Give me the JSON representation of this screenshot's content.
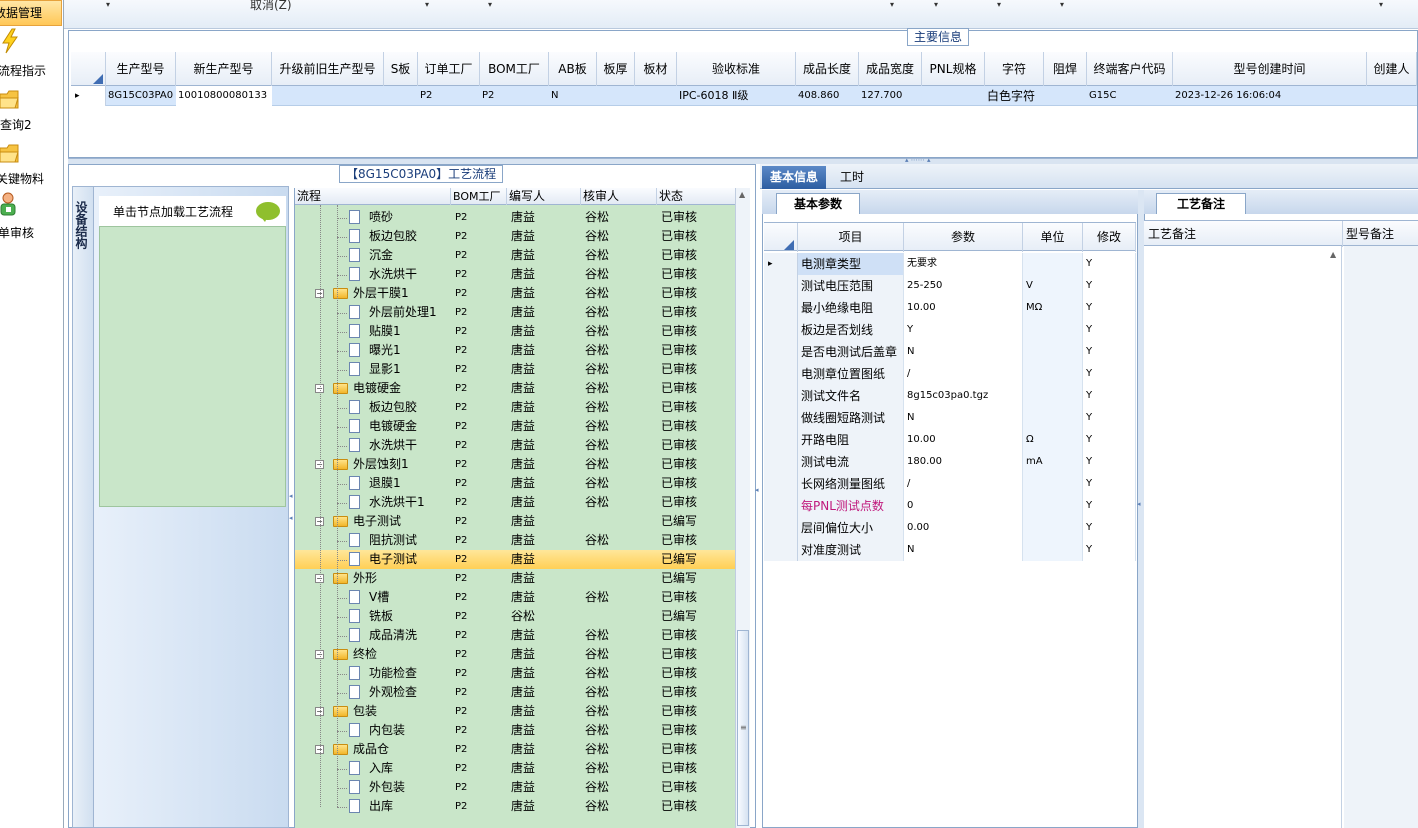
{
  "leftnav": {
    "active_label": "数据管理",
    "items": [
      {
        "label": "流程指示",
        "icon": "lightning-icon"
      },
      {
        "label": "查询2",
        "icon": "folder-icon"
      },
      {
        "label": "关键物料",
        "icon": "folder-icon"
      },
      {
        "label": "单审核",
        "icon": "user-icon"
      }
    ]
  },
  "toolbar": {
    "cancel_label": "取消(Z)"
  },
  "main_info": {
    "legend": "主要信息",
    "columns": [
      "生产型号",
      "新生产型号",
      "升级前旧生产型号",
      "S板",
      "订单工厂",
      "BOM工厂",
      "AB板",
      "板厚",
      "板材",
      "验收标准",
      "成品长度",
      "成品宽度",
      "PNL规格",
      "字符",
      "阻焊",
      "终端客户代码",
      "型号创建时间",
      "创建人"
    ],
    "row": [
      "8G15C03PA0",
      "10010800080133",
      "",
      "",
      "P2",
      "P2",
      "N",
      "",
      "",
      "IPC-6018 Ⅱ级",
      "408.860",
      "127.700",
      "",
      "白色字符",
      "",
      "G15C",
      "2023-12-26 16:06:04",
      ""
    ]
  },
  "process": {
    "legend": "【8G15C03PA0】工艺流程",
    "vtab_label": "设备结构",
    "node_hint": "单击节点加载工艺流程",
    "columns": [
      "流程",
      "BOM工厂",
      "编写人",
      "核审人",
      "状态"
    ],
    "rows": [
      {
        "name": "喷砂",
        "level": 2,
        "bom": "P2",
        "writer": "唐益",
        "reviewer": "谷松",
        "status": "已审核"
      },
      {
        "name": "板边包胶",
        "level": 2,
        "bom": "P2",
        "writer": "唐益",
        "reviewer": "谷松",
        "status": "已审核"
      },
      {
        "name": "沉金",
        "level": 2,
        "bom": "P2",
        "writer": "唐益",
        "reviewer": "谷松",
        "status": "已审核"
      },
      {
        "name": "水洗烘干",
        "level": 2,
        "bom": "P2",
        "writer": "唐益",
        "reviewer": "谷松",
        "status": "已审核"
      },
      {
        "name": "外层干膜1",
        "level": 1,
        "bom": "P2",
        "writer": "唐益",
        "reviewer": "谷松",
        "status": "已审核"
      },
      {
        "name": "外层前处理1",
        "level": 2,
        "bom": "P2",
        "writer": "唐益",
        "reviewer": "谷松",
        "status": "已审核"
      },
      {
        "name": "贴膜1",
        "level": 2,
        "bom": "P2",
        "writer": "唐益",
        "reviewer": "谷松",
        "status": "已审核"
      },
      {
        "name": "曝光1",
        "level": 2,
        "bom": "P2",
        "writer": "唐益",
        "reviewer": "谷松",
        "status": "已审核"
      },
      {
        "name": "显影1",
        "level": 2,
        "bom": "P2",
        "writer": "唐益",
        "reviewer": "谷松",
        "status": "已审核"
      },
      {
        "name": "电镀硬金",
        "level": 1,
        "bom": "P2",
        "writer": "唐益",
        "reviewer": "谷松",
        "status": "已审核"
      },
      {
        "name": "板边包胶",
        "level": 2,
        "bom": "P2",
        "writer": "唐益",
        "reviewer": "谷松",
        "status": "已审核"
      },
      {
        "name": "电镀硬金",
        "level": 2,
        "bom": "P2",
        "writer": "唐益",
        "reviewer": "谷松",
        "status": "已审核"
      },
      {
        "name": "水洗烘干",
        "level": 2,
        "bom": "P2",
        "writer": "唐益",
        "reviewer": "谷松",
        "status": "已审核"
      },
      {
        "name": "外层蚀刻1",
        "level": 1,
        "bom": "P2",
        "writer": "唐益",
        "reviewer": "谷松",
        "status": "已审核"
      },
      {
        "name": "退膜1",
        "level": 2,
        "bom": "P2",
        "writer": "唐益",
        "reviewer": "谷松",
        "status": "已审核"
      },
      {
        "name": "水洗烘干1",
        "level": 2,
        "bom": "P2",
        "writer": "唐益",
        "reviewer": "谷松",
        "status": "已审核"
      },
      {
        "name": "电子测试",
        "level": 1,
        "bom": "P2",
        "writer": "唐益",
        "reviewer": "",
        "status": "已编写"
      },
      {
        "name": "阻抗测试",
        "level": 2,
        "bom": "P2",
        "writer": "唐益",
        "reviewer": "谷松",
        "status": "已审核"
      },
      {
        "name": "电子测试",
        "level": 2,
        "bom": "P2",
        "writer": "唐益",
        "reviewer": "",
        "status": "已编写",
        "selected": true
      },
      {
        "name": "外形",
        "level": 1,
        "bom": "P2",
        "writer": "唐益",
        "reviewer": "",
        "status": "已编写"
      },
      {
        "name": "V槽",
        "level": 2,
        "bom": "P2",
        "writer": "唐益",
        "reviewer": "谷松",
        "status": "已审核"
      },
      {
        "name": "铣板",
        "level": 2,
        "bom": "P2",
        "writer": "谷松",
        "reviewer": "",
        "status": "已编写"
      },
      {
        "name": "成品清洗",
        "level": 2,
        "bom": "P2",
        "writer": "唐益",
        "reviewer": "谷松",
        "status": "已审核"
      },
      {
        "name": "终检",
        "level": 1,
        "bom": "P2",
        "writer": "唐益",
        "reviewer": "谷松",
        "status": "已审核"
      },
      {
        "name": "功能检查",
        "level": 2,
        "bom": "P2",
        "writer": "唐益",
        "reviewer": "谷松",
        "status": "已审核"
      },
      {
        "name": "外观检查",
        "level": 2,
        "bom": "P2",
        "writer": "唐益",
        "reviewer": "谷松",
        "status": "已审核"
      },
      {
        "name": "包装",
        "level": 1,
        "bom": "P2",
        "writer": "唐益",
        "reviewer": "谷松",
        "status": "已审核"
      },
      {
        "name": "内包装",
        "level": 2,
        "bom": "P2",
        "writer": "唐益",
        "reviewer": "谷松",
        "status": "已审核"
      },
      {
        "name": "成品仓",
        "level": 1,
        "bom": "P2",
        "writer": "唐益",
        "reviewer": "谷松",
        "status": "已审核"
      },
      {
        "name": "入库",
        "level": 2,
        "bom": "P2",
        "writer": "唐益",
        "reviewer": "谷松",
        "status": "已审核"
      },
      {
        "name": "外包装",
        "level": 2,
        "bom": "P2",
        "writer": "唐益",
        "reviewer": "谷松",
        "status": "已审核"
      },
      {
        "name": "出库",
        "level": 2,
        "bom": "P2",
        "writer": "唐益",
        "reviewer": "谷松",
        "status": "已审核"
      }
    ]
  },
  "right_tabs": {
    "basic": "基本信息",
    "hours": "工时"
  },
  "params": {
    "tab": "基本参数",
    "columns": [
      "项目",
      "参数",
      "单位",
      "修改"
    ],
    "rows": [
      {
        "item": "电测章类型",
        "value": "无要求",
        "unit": "",
        "edit": "Y",
        "current": true
      },
      {
        "item": "测试电压范围",
        "value": "25-250",
        "unit": "V",
        "edit": "Y"
      },
      {
        "item": "最小绝缘电阻",
        "value": "10.00",
        "unit": "MΩ",
        "edit": "Y"
      },
      {
        "item": "板边是否划线",
        "value": "Y",
        "unit": "",
        "edit": "Y"
      },
      {
        "item": "是否电测试后盖章",
        "value": "N",
        "unit": "",
        "edit": "Y"
      },
      {
        "item": "电测章位置图纸",
        "value": "/",
        "unit": "",
        "edit": "Y"
      },
      {
        "item": "测试文件名",
        "value": "8g15c03pa0.tgz",
        "unit": "",
        "edit": "Y"
      },
      {
        "item": "做线圈短路测试",
        "value": "N",
        "unit": "",
        "edit": "Y"
      },
      {
        "item": "开路电阻",
        "value": "10.00",
        "unit": "Ω",
        "edit": "Y"
      },
      {
        "item": "测试电流",
        "value": "180.00",
        "unit": "mA",
        "edit": "Y"
      },
      {
        "item": "长网络测量图纸",
        "value": "/",
        "unit": "",
        "edit": "Y"
      },
      {
        "item": "每PNL测试点数",
        "value": "0",
        "unit": "",
        "edit": "Y",
        "pink": true
      },
      {
        "item": "层间偏位大小",
        "value": "0.00",
        "unit": "",
        "edit": "Y"
      },
      {
        "item": "对准度测试",
        "value": "N",
        "unit": "",
        "edit": "Y"
      }
    ]
  },
  "remarks": {
    "tab": "工艺备注",
    "col1": "工艺备注",
    "col2": "型号备注"
  }
}
